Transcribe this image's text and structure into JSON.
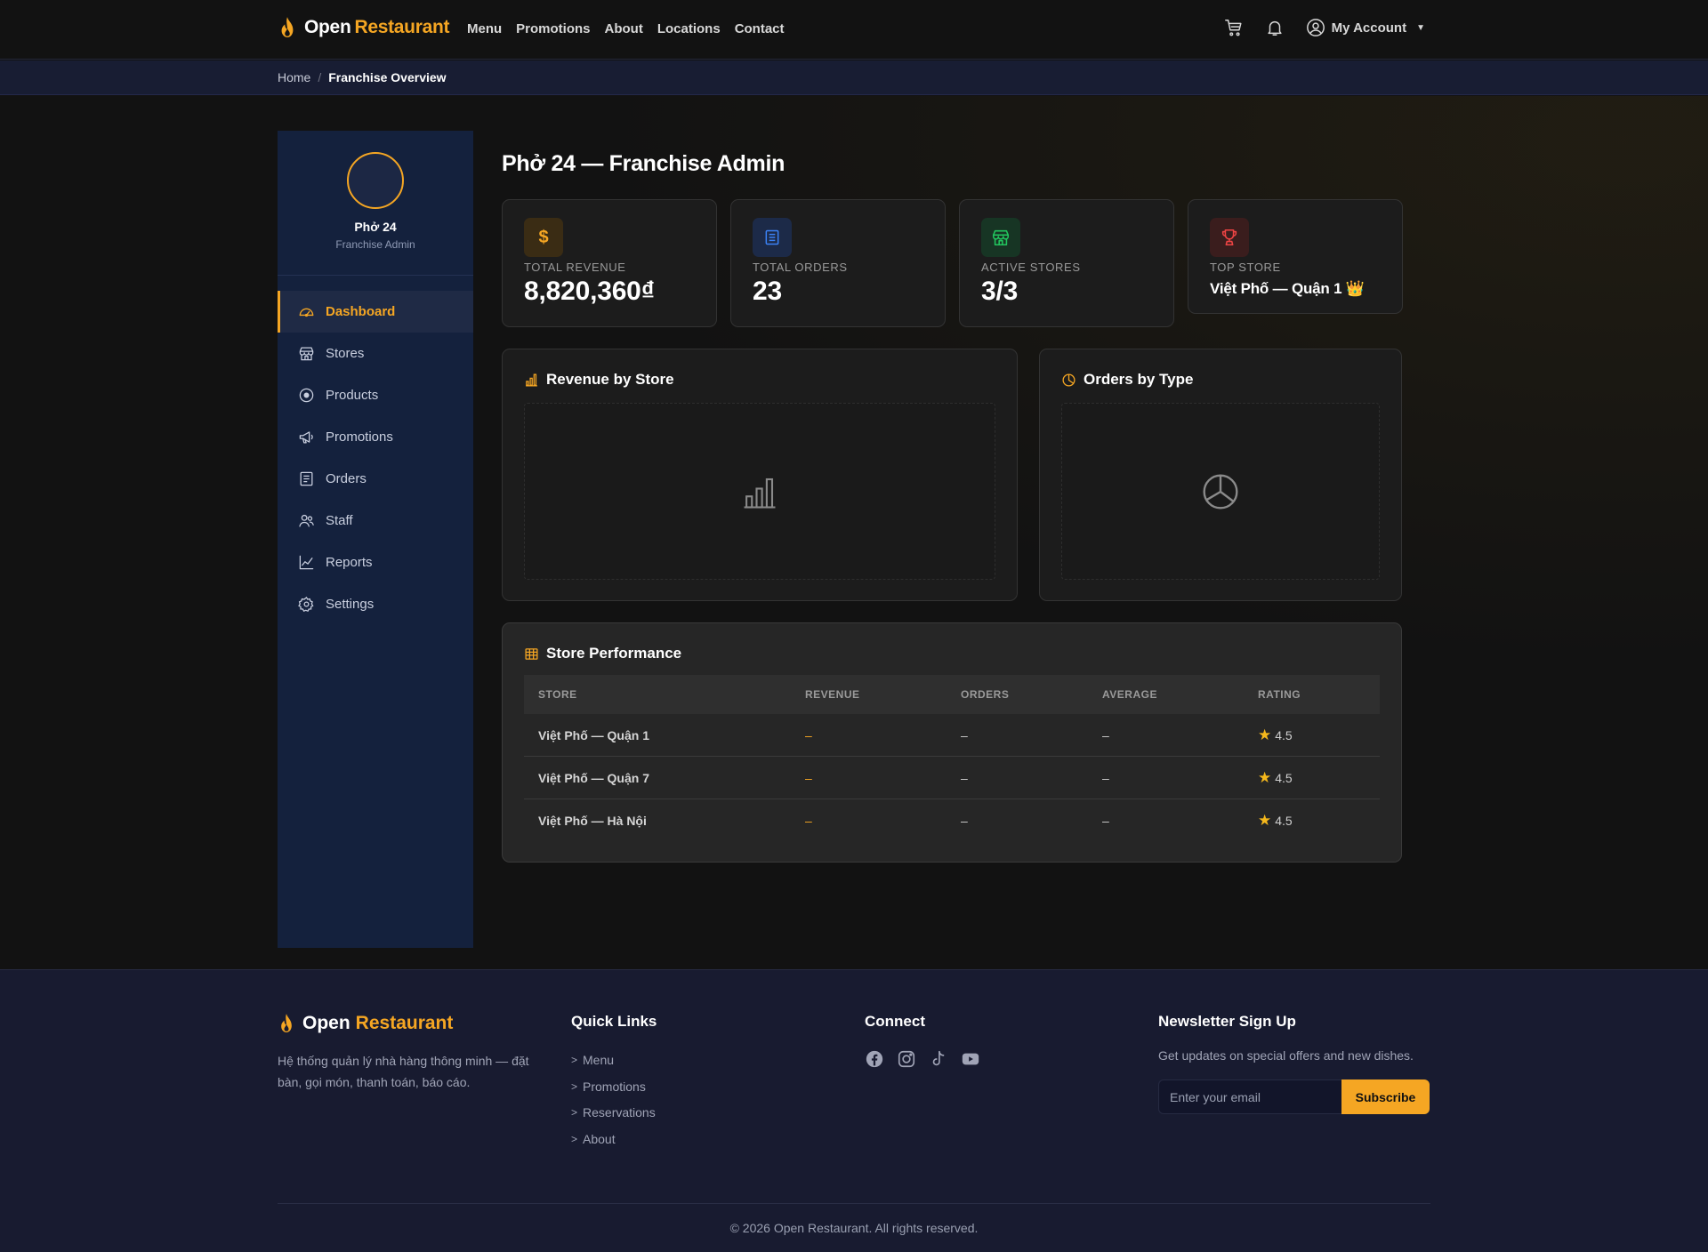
{
  "brand": {
    "part1": "Open",
    "part2": "Restaurant"
  },
  "nav": {
    "links": [
      "Menu",
      "Promotions",
      "About",
      "Locations",
      "Contact"
    ],
    "account": "My Account"
  },
  "breadcrumb": {
    "home": "Home",
    "separator": "/",
    "current": "Franchise Overview"
  },
  "sidebar": {
    "name": "Phở 24",
    "role": "Franchise Admin",
    "items": [
      {
        "label": "Dashboard",
        "icon": "dashboard-icon"
      },
      {
        "label": "Stores",
        "icon": "store-icon"
      },
      {
        "label": "Products",
        "icon": "product-icon"
      },
      {
        "label": "Promotions",
        "icon": "megaphone-icon"
      },
      {
        "label": "Orders",
        "icon": "receipt-icon"
      },
      {
        "label": "Staff",
        "icon": "people-icon"
      },
      {
        "label": "Reports",
        "icon": "chart-line-icon"
      },
      {
        "label": "Settings",
        "icon": "gear-icon"
      }
    ]
  },
  "page": {
    "title": "Phở 24 — Franchise Admin"
  },
  "stats": [
    {
      "label": "TOTAL REVENUE",
      "value": "8,820,360₫",
      "icon": "dollar-icon",
      "color": "#f5a623"
    },
    {
      "label": "TOTAL ORDERS",
      "value": "23",
      "icon": "receipt-icon",
      "color": "#3b82f6"
    },
    {
      "label": "ACTIVE STORES",
      "value": "3/3",
      "icon": "shop-icon",
      "color": "#22c55e"
    },
    {
      "label": "TOP STORE",
      "value": "Việt Phố — Quận 1 👑",
      "icon": "trophy-icon",
      "color": "#ef4444"
    }
  ],
  "cards": {
    "revenue_title": "Revenue by Store",
    "orders_title": "Orders by Type"
  },
  "performance": {
    "title": "Store Performance",
    "columns": [
      "STORE",
      "REVENUE",
      "ORDERS",
      "AVERAGE",
      "RATING"
    ],
    "rows": [
      {
        "store": "Việt Phố — Quận 1",
        "revenue": "–",
        "orders": "–",
        "average": "–",
        "rating": "4.5"
      },
      {
        "store": "Việt Phố — Quận 7",
        "revenue": "–",
        "orders": "–",
        "average": "–",
        "rating": "4.5"
      },
      {
        "store": "Việt Phố — Hà Nội",
        "revenue": "–",
        "orders": "–",
        "average": "–",
        "rating": "4.5"
      }
    ]
  },
  "footer": {
    "desc": "Hệ thống quản lý nhà hàng thông minh — đặt bàn, gọi món, thanh toán, báo cáo.",
    "quick_title": "Quick Links",
    "quick_links": [
      "Menu",
      "Promotions",
      "Reservations",
      "About"
    ],
    "connect_title": "Connect",
    "socials": [
      "facebook-icon",
      "instagram-icon",
      "tiktok-icon",
      "youtube-icon"
    ],
    "newsletter_title": "Newsletter Sign Up",
    "newsletter_text": "Get updates on special offers and new dishes.",
    "email_placeholder": "Enter your email",
    "subscribe": "Subscribe",
    "copyright": "© 2026 Open Restaurant. All rights reserved."
  },
  "colors": {
    "accent": "#f5a623",
    "sidebar": "#14213d",
    "footer": "#181b30"
  }
}
